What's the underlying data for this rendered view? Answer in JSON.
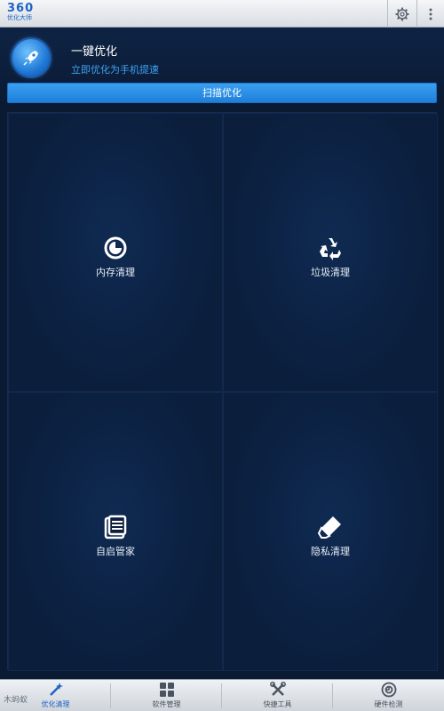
{
  "app": {
    "logo_number": "360",
    "logo_sub": "优化大师"
  },
  "header": {
    "title": "一键优化",
    "subtitle": "立即优化为手机提速",
    "scan_button": "扫描优化"
  },
  "tiles": [
    {
      "label": "内存清理",
      "icon": "memory-clean-icon"
    },
    {
      "label": "垃圾清理",
      "icon": "recycle-icon"
    },
    {
      "label": "自启管家",
      "icon": "list-icon"
    },
    {
      "label": "隐私清理",
      "icon": "eraser-icon"
    }
  ],
  "bottom_nav": [
    {
      "label": "优化清理",
      "icon": "wand-icon",
      "active": true
    },
    {
      "label": "软件管理",
      "icon": "grid-apps-icon",
      "active": false
    },
    {
      "label": "快捷工具",
      "icon": "tools-icon",
      "active": false
    },
    {
      "label": "硬件检测",
      "icon": "gauge-icon",
      "active": false
    }
  ],
  "watermark": "木蚂蚁",
  "colors": {
    "accent": "#1f7fda",
    "subtitle": "#3fa3f4",
    "background": "#0b1a33"
  }
}
